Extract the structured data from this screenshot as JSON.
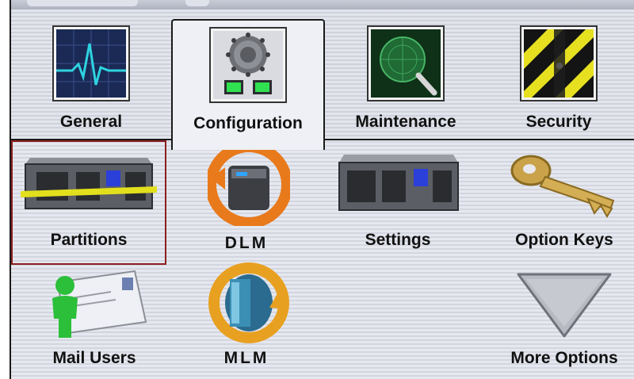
{
  "tabs": [
    {
      "label": "General",
      "icon": "heart-monitor-icon"
    },
    {
      "label": "Configuration",
      "icon": "dial-gauge-icon",
      "active": true
    },
    {
      "label": "Maintenance",
      "icon": "magnifier-radar-icon"
    },
    {
      "label": "Security",
      "icon": "hazard-stripes-icon"
    }
  ],
  "items": [
    {
      "label": "Partitions",
      "icon": "library-partitions-icon",
      "selected": true
    },
    {
      "label": "DLM",
      "icon": "drive-lifecycle-icon"
    },
    {
      "label": "Settings",
      "icon": "library-unit-icon"
    },
    {
      "label": "Option Keys",
      "icon": "key-icon"
    },
    {
      "label": "Mail Users",
      "icon": "mail-user-icon"
    },
    {
      "label": "MLM",
      "icon": "media-lifecycle-icon"
    },
    {
      "label": "More Options",
      "icon": "down-triangle-icon"
    }
  ],
  "colors": {
    "selection_border": "#8c1f1f",
    "background": "#e6e8ef",
    "accent_green": "#22cc44",
    "accent_orange": "#e87a1c"
  }
}
